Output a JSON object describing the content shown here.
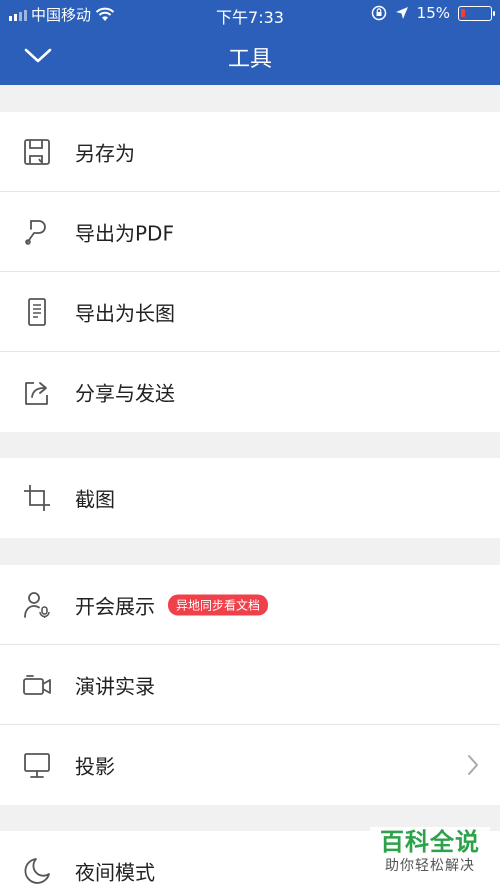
{
  "status_bar": {
    "carrier": "中国移动",
    "time": "下午7:33",
    "battery_percent": "15%"
  },
  "header": {
    "title": "工具"
  },
  "colors": {
    "header_bg": "#2b5fb9",
    "badge_bg": "#f0404a",
    "watermark_green": "#2ea24a"
  },
  "groups": [
    {
      "items": [
        {
          "label": "另存为",
          "icon": "save-icon"
        },
        {
          "label": "导出为PDF",
          "icon": "pdf-icon"
        },
        {
          "label": "导出为长图",
          "icon": "long-image-icon"
        },
        {
          "label": "分享与发送",
          "icon": "share-icon"
        }
      ]
    },
    {
      "items": [
        {
          "label": "截图",
          "icon": "crop-icon"
        }
      ]
    },
    {
      "items": [
        {
          "label": "开会展示",
          "icon": "meeting-icon",
          "badge": "异地同步看文档"
        },
        {
          "label": "演讲实录",
          "icon": "video-record-icon"
        },
        {
          "label": "投影",
          "icon": "projection-icon",
          "has_chevron": true
        }
      ]
    },
    {
      "items": [
        {
          "label": "夜间模式",
          "icon": "moon-icon"
        }
      ]
    }
  ],
  "watermark": {
    "title": "百科全说",
    "subtitle": "助你轻松解决"
  }
}
